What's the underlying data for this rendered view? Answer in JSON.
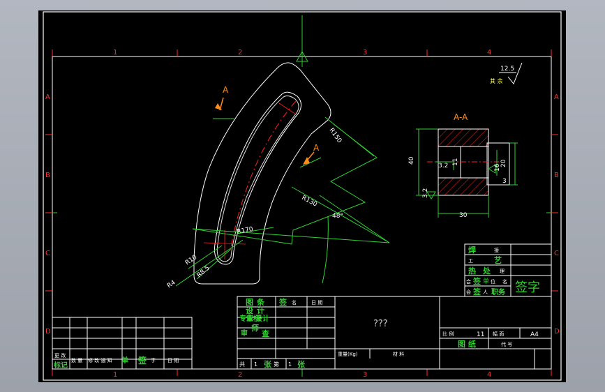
{
  "drawing": {
    "zone_cols": [
      "1",
      "2",
      "3",
      "4"
    ],
    "zone_rows": [
      "A",
      "B",
      "C",
      "D"
    ],
    "roughness": "12.5",
    "roughness_note": "其 余",
    "section_label": "A-A",
    "view_marker": "A",
    "dimensions": {
      "r150": "R150",
      "r130": "R130",
      "r170": "R170",
      "r10": "R10",
      "r8_5": "R8.5",
      "r4": "R4",
      "angle": "48°",
      "sec_height": "40",
      "sec_width": "30",
      "sec_20": "20",
      "sec_16": "16",
      "sec_11": "11",
      "sec_3_2a": "3.2",
      "sec_3_2b": "3.2",
      "sec_3": "3"
    }
  },
  "title_block": {
    "title": "???",
    "row_weld": "焊",
    "row_weld_b": "接",
    "row_process": "工",
    "row_process_b": "艺",
    "row_heat": "热",
    "row_heat_b": "处",
    "row_heat_c": "理",
    "row_unit_a": "会",
    "row_unit_b": "签",
    "row_unit_c": "单",
    "row_unit_d": "位",
    "row_unit_e": "名",
    "row_sign_a": "会",
    "row_sign_b": "签",
    "row_sign_c": "人",
    "row_sign_d": "职务",
    "sign_big": "签字",
    "design_a": "图",
    "design_b": "条",
    "design_c": "设",
    "design_d": "计",
    "sign_hdr_a": "签",
    "sign_hdr_b": "名",
    "date_hdr": "日 期",
    "prof_a": "专业",
    "prof_b": "审核",
    "prof_c": "设计",
    "audit_a": "审",
    "audit_b": "师",
    "audit_c": "查",
    "scale_label": "比 例",
    "scale_value": "11",
    "size_label": "幅 面",
    "size_value": "A4",
    "sheet_name": "图 纸",
    "code_label": "代 号",
    "weight_label": "重量(Kg)",
    "material_label": "材 料",
    "sheet_total_a": "共",
    "sheet_total_b": "1",
    "sheet_total_c": "张",
    "sheet_no_a": "第",
    "sheet_no_b": "1",
    "sheet_no_c": "张",
    "rev_a": "更 改",
    "rev_b": "标记",
    "rev_c": "数 量",
    "rev_d": "修 改 通 知",
    "rev_e": "单",
    "rev_f": "签",
    "rev_g": "字",
    "rev_h": "日 期"
  }
}
